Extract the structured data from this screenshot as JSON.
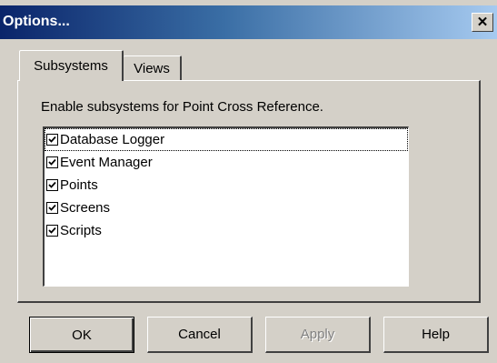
{
  "window": {
    "title": "Options...",
    "close_label": "✕"
  },
  "tabs": [
    {
      "label": "Subsystems",
      "active": true
    },
    {
      "label": "Views",
      "active": false
    }
  ],
  "panel": {
    "instruction": "Enable subsystems for Point Cross Reference.",
    "items": [
      {
        "label": "Database Logger",
        "checked": true,
        "focused": true
      },
      {
        "label": "Event Manager",
        "checked": true
      },
      {
        "label": "Points",
        "checked": true
      },
      {
        "label": "Screens",
        "checked": true
      },
      {
        "label": "Scripts",
        "checked": true
      }
    ]
  },
  "buttons": {
    "ok": "OK",
    "cancel": "Cancel",
    "apply": "Apply",
    "help": "Help"
  }
}
